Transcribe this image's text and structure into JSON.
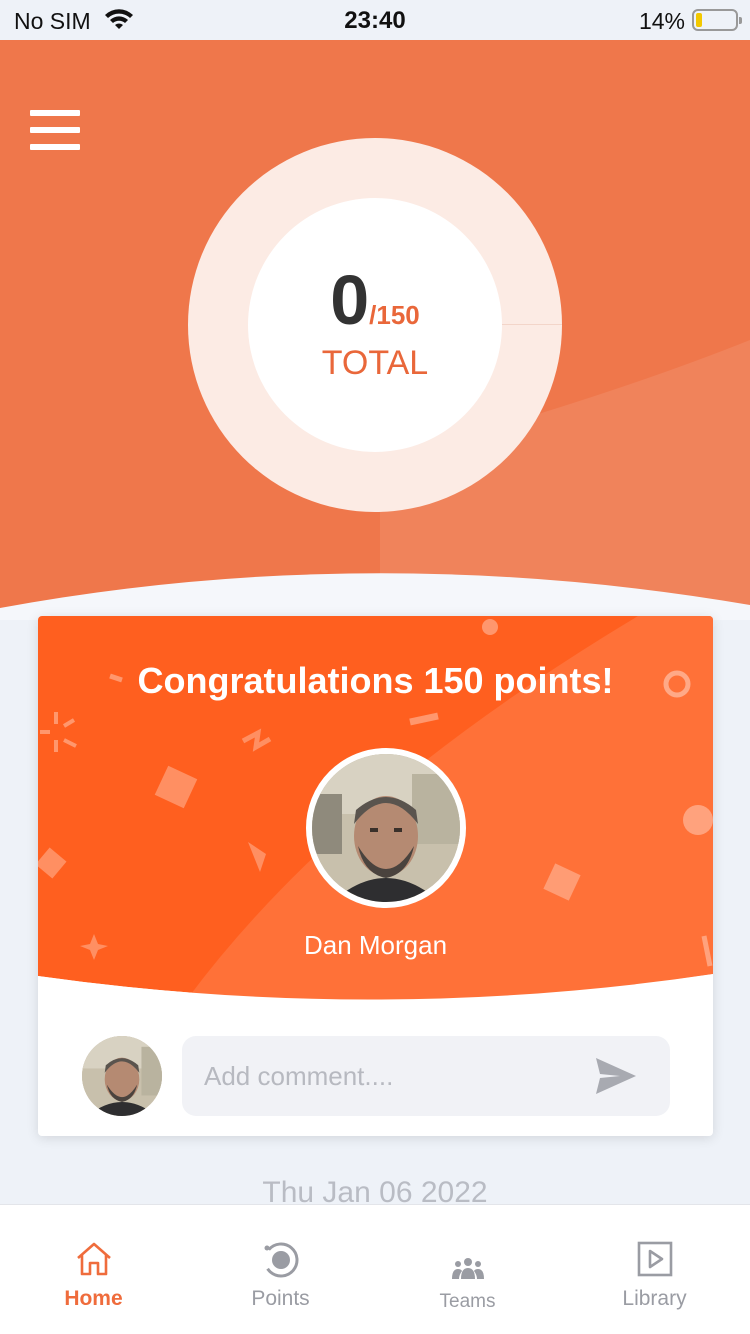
{
  "status_bar": {
    "carrier": "No SIM",
    "time": "23:40",
    "battery": "14%"
  },
  "score": {
    "value": "0",
    "total": "/150",
    "label": "TOTAL"
  },
  "card": {
    "title": "Congratulations 150 points!",
    "person_name": "Dan Morgan",
    "comment_placeholder": "Add comment...."
  },
  "feed": {
    "date": "Thu Jan 06 2022"
  },
  "tabs": [
    {
      "label": "Home",
      "icon": "home-icon",
      "active": true
    },
    {
      "label": "Points",
      "icon": "points-icon",
      "active": false
    },
    {
      "label": "Teams",
      "icon": "teams-icon",
      "active": false
    },
    {
      "label": "Library",
      "icon": "library-icon",
      "active": false
    }
  ],
  "colors": {
    "accent": "#ef6c3c",
    "banner": "#ff5f1f",
    "header": "#ef774b"
  }
}
